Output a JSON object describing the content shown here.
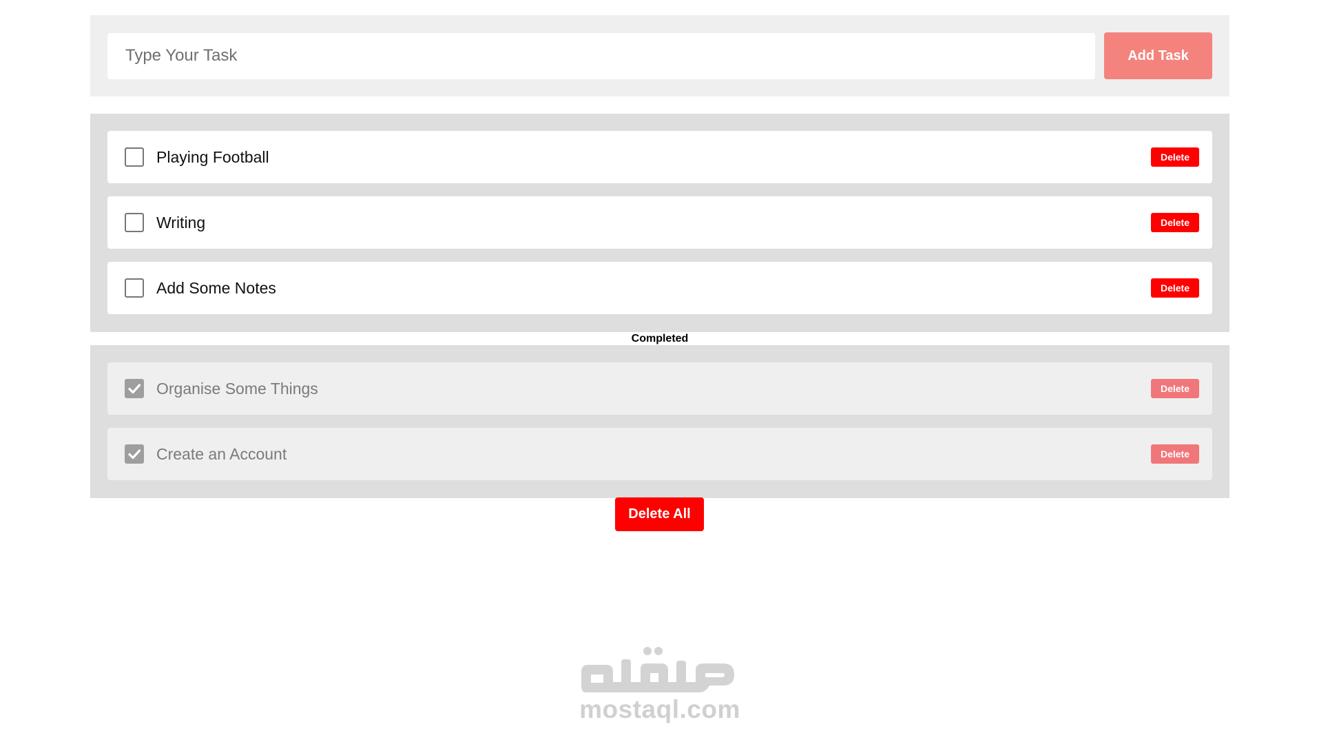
{
  "composer": {
    "input_value": "",
    "input_placeholder": "Type Your Task",
    "add_label": "Add Task"
  },
  "pending_tasks": [
    {
      "label": "Playing Football",
      "checked": false,
      "delete_label": "Delete"
    },
    {
      "label": "Writing",
      "checked": false,
      "delete_label": "Delete"
    },
    {
      "label": "Add Some Notes",
      "checked": false,
      "delete_label": "Delete"
    }
  ],
  "completed_heading": "Completed",
  "completed_tasks": [
    {
      "label": "Organise Some Things",
      "checked": true,
      "delete_label": "Delete"
    },
    {
      "label": "Create an Account",
      "checked": true,
      "delete_label": "Delete"
    }
  ],
  "delete_all_label": "Delete All",
  "watermark": {
    "text": "mostaql.com"
  },
  "colors": {
    "add_button": "#f4837d",
    "delete_button": "#ff0000",
    "delete_button_completed": "#f1767a",
    "panel_background": "#dedede",
    "input_panel_background": "#efefef"
  },
  "icons": {
    "checked": "checkmark-icon",
    "unchecked": "empty-checkbox"
  }
}
